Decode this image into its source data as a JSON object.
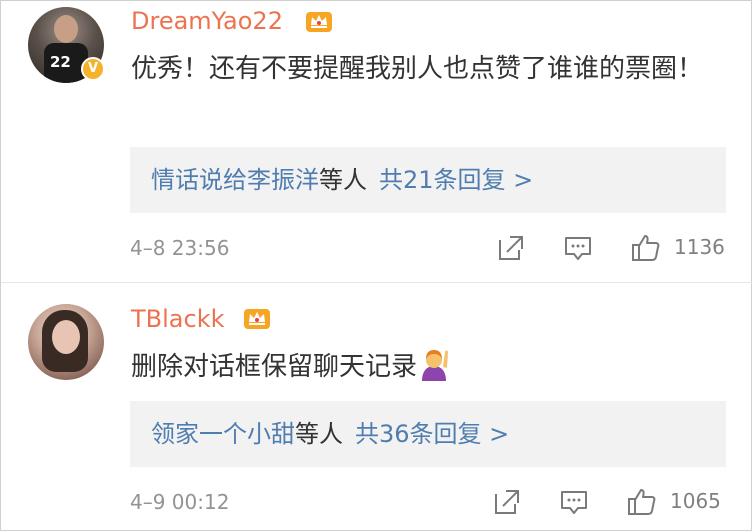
{
  "comments": [
    {
      "username": "DreamYao22",
      "avatar_badge": "V",
      "text": "优秀！还有不要提醒我别人也点赞了谁谁的票圈！",
      "reply": {
        "names": "情话说给李振洋",
        "suffix": "等人",
        "count_text": "共21条回复 >"
      },
      "time": "4–8 23:56",
      "likes": "1136",
      "icons": [
        "repost-icon",
        "comment-icon",
        "like-icon",
        "crown-badge-icon",
        "verified-badge-icon"
      ]
    },
    {
      "username": "TBlackk",
      "text": "删除对话框保留聊天记录",
      "emoji": "raising-hand-emoji",
      "reply": {
        "names": "领家一个小甜",
        "suffix": "等人",
        "count_text": "共36条回复 >"
      },
      "time": "4–9 00:12",
      "likes": "1065",
      "icons": [
        "repost-icon",
        "comment-icon",
        "like-icon",
        "crown-badge-icon"
      ]
    }
  ],
  "colors": {
    "username": "#eb7350",
    "link": "#507daf",
    "text": "#333333",
    "meta": "#939393",
    "reply_bg": "#f2f2f2",
    "badge": "#f7b22b"
  }
}
